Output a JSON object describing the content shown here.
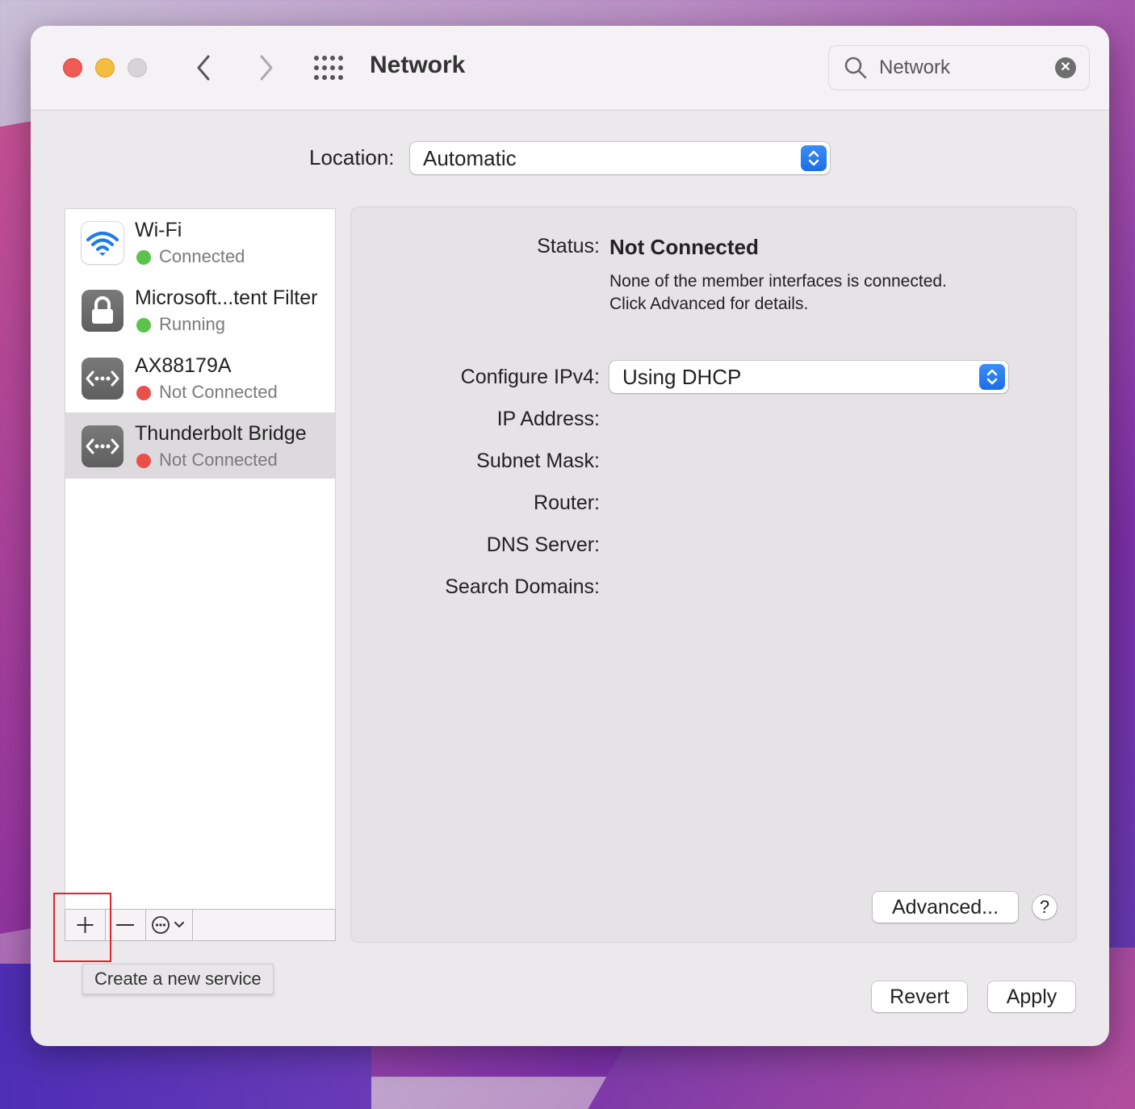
{
  "window": {
    "title": "Network",
    "search": {
      "value": "Network"
    }
  },
  "location": {
    "label": "Location:",
    "value": "Automatic"
  },
  "services": [
    {
      "name": "Wi-Fi",
      "status": "Connected",
      "status_color": "#5bc24a",
      "icon": "wifi-icon"
    },
    {
      "name": "Microsoft...tent Filter",
      "status": "Running",
      "status_color": "#5bc24a",
      "icon": "lock-icon"
    },
    {
      "name": "AX88179A",
      "status": "Not Connected",
      "status_color": "#e9504a",
      "icon": "ethernet-icon"
    },
    {
      "name": "Thunderbolt Bridge",
      "status": "Not Connected",
      "status_color": "#e9504a",
      "icon": "ethernet-icon",
      "selected": true
    }
  ],
  "tooltip": "Create a new service",
  "detail": {
    "status_label": "Status:",
    "status_value": "Not Connected",
    "status_desc_line1": "None of the member interfaces is connected.",
    "status_desc_line2": "Click Advanced for details.",
    "configure_label": "Configure IPv4:",
    "configure_value": "Using DHCP",
    "ip_label": "IP Address:",
    "subnet_label": "Subnet Mask:",
    "router_label": "Router:",
    "dns_label": "DNS Server:",
    "search_domains_label": "Search Domains:",
    "advanced_label": "Advanced...",
    "help_label": "?"
  },
  "footer": {
    "revert_label": "Revert",
    "apply_label": "Apply"
  }
}
